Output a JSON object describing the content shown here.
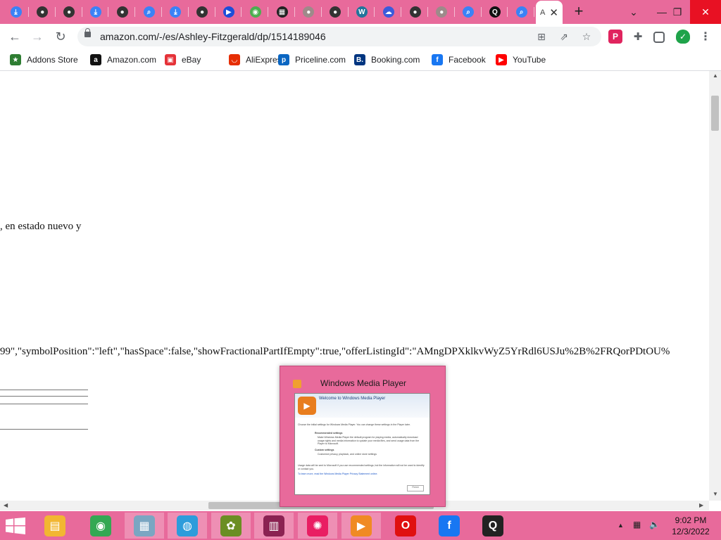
{
  "browser": {
    "tabs": [
      {
        "icon": "download-icon",
        "color": "#3b82f6"
      },
      {
        "icon": "globe-icon",
        "color": "#333333"
      },
      {
        "icon": "globe-icon",
        "color": "#333333"
      },
      {
        "icon": "download-icon",
        "color": "#3b82f6"
      },
      {
        "icon": "globe-icon",
        "color": "#333333"
      },
      {
        "icon": "search-icon",
        "color": "#3b82f6"
      },
      {
        "icon": "download-icon",
        "color": "#3b82f6"
      },
      {
        "icon": "globe-icon",
        "color": "#333333"
      },
      {
        "icon": "arrow-icon",
        "color": "#1d4ed8"
      },
      {
        "icon": "chrome-icon",
        "color": "#4caf50"
      },
      {
        "icon": "grid-icon",
        "color": "#222222"
      },
      {
        "icon": "globe-icon",
        "color": "#9e8a8a"
      },
      {
        "icon": "globe-icon",
        "color": "#333333"
      },
      {
        "icon": "wordpress-icon",
        "color": "#21759b"
      },
      {
        "icon": "cloud-icon",
        "color": "#3b5bdb"
      },
      {
        "icon": "globe-icon",
        "color": "#333333"
      },
      {
        "icon": "globe-icon",
        "color": "#9e8a8a"
      },
      {
        "icon": "search-icon",
        "color": "#3b82f6"
      },
      {
        "icon": "q-icon",
        "color": "#111111"
      },
      {
        "icon": "search-icon",
        "color": "#3b82f6"
      }
    ],
    "active_tab_label": "A",
    "address": "amazon.com/-/es/Ashley-Fitzgerald/dp/1514189046",
    "bookmarks": [
      {
        "label": "Addons Store",
        "icon": "addons-icon",
        "color": "#2e7d32",
        "glyph": "★"
      },
      {
        "label": "Amazon.com",
        "icon": "amazon-icon",
        "color": "#111111",
        "glyph": "a"
      },
      {
        "label": "eBay",
        "icon": "ebay-icon",
        "color": "#e53238",
        "glyph": "▣"
      },
      {
        "label": "AliExpress",
        "icon": "aliexpress-icon",
        "color": "#e62e04",
        "glyph": "◡"
      },
      {
        "label": "Priceline.com",
        "icon": "priceline-icon",
        "color": "#0a66c2",
        "glyph": "p"
      },
      {
        "label": "Booking.com",
        "icon": "booking-icon",
        "color": "#003580",
        "glyph": "B."
      },
      {
        "label": "Facebook",
        "icon": "facebook-icon",
        "color": "#1877f2",
        "glyph": "f"
      },
      {
        "label": "YouTube",
        "icon": "youtube-icon",
        "color": "#ff0000",
        "glyph": "▶"
      }
    ]
  },
  "page": {
    "text_line_1": ", en estado nuevo y",
    "text_line_2": "99\",\"symbolPosition\":\"left\",\"hasSpace\":false,\"showFractionalPartIfEmpty\":true,\"offerListingId\":\"AMngDPXklkvWyZ5YrRdl6USJu%2B%2FRQorPDtOU%"
  },
  "wmp_dialog": {
    "title": "Windows Media Player",
    "welcome": "Welcome to Windows Media Player",
    "intro": "Choose the initial settings for Windows Media Player. You can change these settings in the Player later.",
    "recommended_label": "Recommended settings",
    "recommended_desc": "Make Windows Media Player the default program for playing media, automatically download usage rights and media information to update your media files, and send usage data from the Player to Microsoft.",
    "custom_label": "Custom settings",
    "custom_desc": "Customize privacy, playback, and online store settings",
    "footer_note": "Usage data will be sent to Microsoft if you use recommended settings, but the information will not be used to identify or contact you.",
    "privacy_link": "To learn more, read the Windows Media Player Privacy Statement online.",
    "finish_label": "Finish"
  },
  "taskbar": {
    "apps": [
      {
        "name": "file-explorer",
        "icon": "folder-icon",
        "color": "#f2b632",
        "glyph": "▤"
      },
      {
        "name": "chrome",
        "icon": "chrome-icon",
        "color": "#34a853",
        "glyph": "◉"
      },
      {
        "name": "resource-monitor",
        "icon": "monitor-icon",
        "color": "#7aa6c2",
        "glyph": "▦"
      },
      {
        "name": "vpn",
        "icon": "shield-icon",
        "color": "#2d9cdb",
        "glyph": "◍"
      },
      {
        "name": "game",
        "icon": "game-icon",
        "color": "#6b8e23",
        "glyph": "✿"
      },
      {
        "name": "winrar",
        "icon": "archive-icon",
        "color": "#8b2252",
        "glyph": "▥"
      },
      {
        "name": "media-center",
        "icon": "media-center-icon",
        "color": "#e91e63",
        "glyph": "✺"
      },
      {
        "name": "windows-media-player",
        "icon": "wmp-icon",
        "color": "#f08a24",
        "glyph": "▶"
      },
      {
        "name": "opera",
        "icon": "opera-icon",
        "color": "#e01010",
        "glyph": "O"
      },
      {
        "name": "facebook",
        "icon": "facebook-icon",
        "color": "#1877f2",
        "glyph": "f"
      },
      {
        "name": "quicktime",
        "icon": "q-icon",
        "color": "#222222",
        "glyph": "Q"
      }
    ],
    "time": "9:02 PM",
    "date": "12/3/2022"
  }
}
